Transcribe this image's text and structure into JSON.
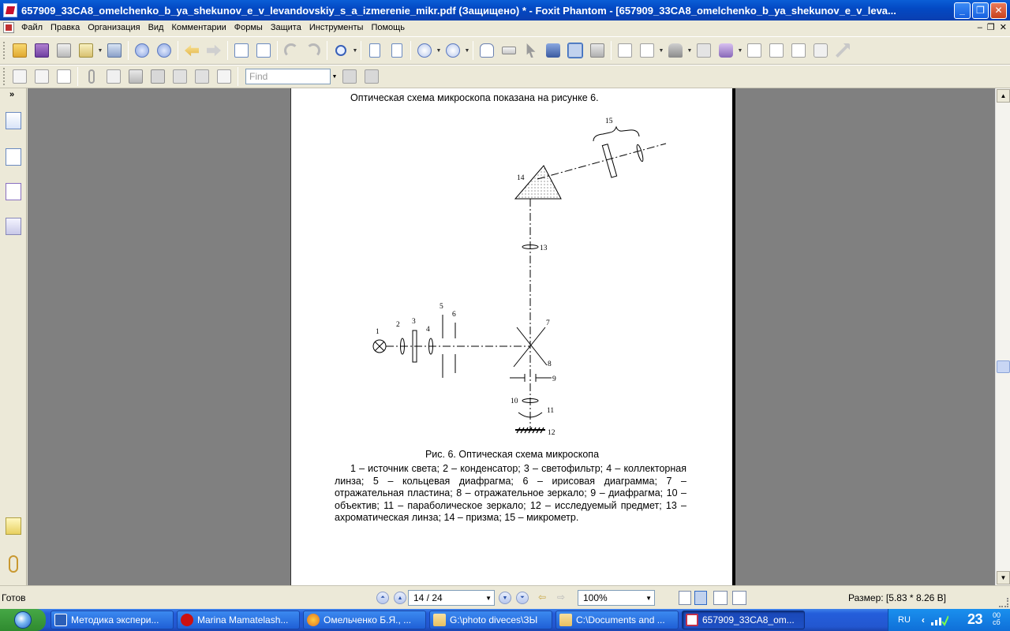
{
  "window": {
    "title": "657909_33CA8_omelchenko_b_ya_shekunov_e_v_levandovskiy_s_a_izmerenie_mikr.pdf (Защищено) * - Foxit Phantom - [657909_33CA8_omelchenko_b_ya_shekunov_e_v_leva..."
  },
  "menu": {
    "items": [
      "Файл",
      "Правка",
      "Организация",
      "Вид",
      "Комментарии",
      "Формы",
      "Защита",
      "Инструменты",
      "Помощь"
    ],
    "mdi": [
      "–",
      "❐",
      "✕"
    ]
  },
  "toolbar2": {
    "find_placeholder": "Find"
  },
  "document": {
    "heading": "Оптическая схема микроскопа показана на рисунке 6.",
    "figure_labels": [
      "1",
      "2",
      "3",
      "4",
      "5",
      "6",
      "7",
      "8",
      "9",
      "10",
      "11",
      "12",
      "13",
      "14",
      "15"
    ],
    "caption": "Рис. 6. Оптическая схема микроскопа",
    "legend": "1 – источник света; 2 – конденсатор; 3 – светофильтр; 4 – коллекторная линза; 5 – кольцевая диафрагма; 6 – ирисовая диаграмма; 7 – отражательная пластина; 8 – отражательное зеркало; 9 – диафрагма; 10 – объектив; 11 – параболическое зеркало; 12 – исследуемый предмет; 13 – ахроматическая линза; 14 – призма; 15 – микрометр."
  },
  "status": {
    "ready": "Готов",
    "page": "14 / 24",
    "zoom": "100%",
    "size": "Размер: [5.83 * 8.26 В]"
  },
  "taskbar": {
    "tasks": [
      {
        "label": "Методика экспери...",
        "color": "#2b5fb8"
      },
      {
        "label": "Marina Mamatelash...",
        "color": "#cc1111"
      },
      {
        "label": "Омельченко Б.Я., ...",
        "color": "#e07020"
      },
      {
        "label": "G:\\photo diveces\\ЗЫ",
        "color": "#e8c060"
      },
      {
        "label": "C:\\Documents and ...",
        "color": "#e8c060"
      },
      {
        "label": "657909_33CA8_om...",
        "color": "#c0304a"
      }
    ],
    "lang": "RU",
    "time": "23",
    "minutes": "00",
    "seconds": "сб"
  }
}
